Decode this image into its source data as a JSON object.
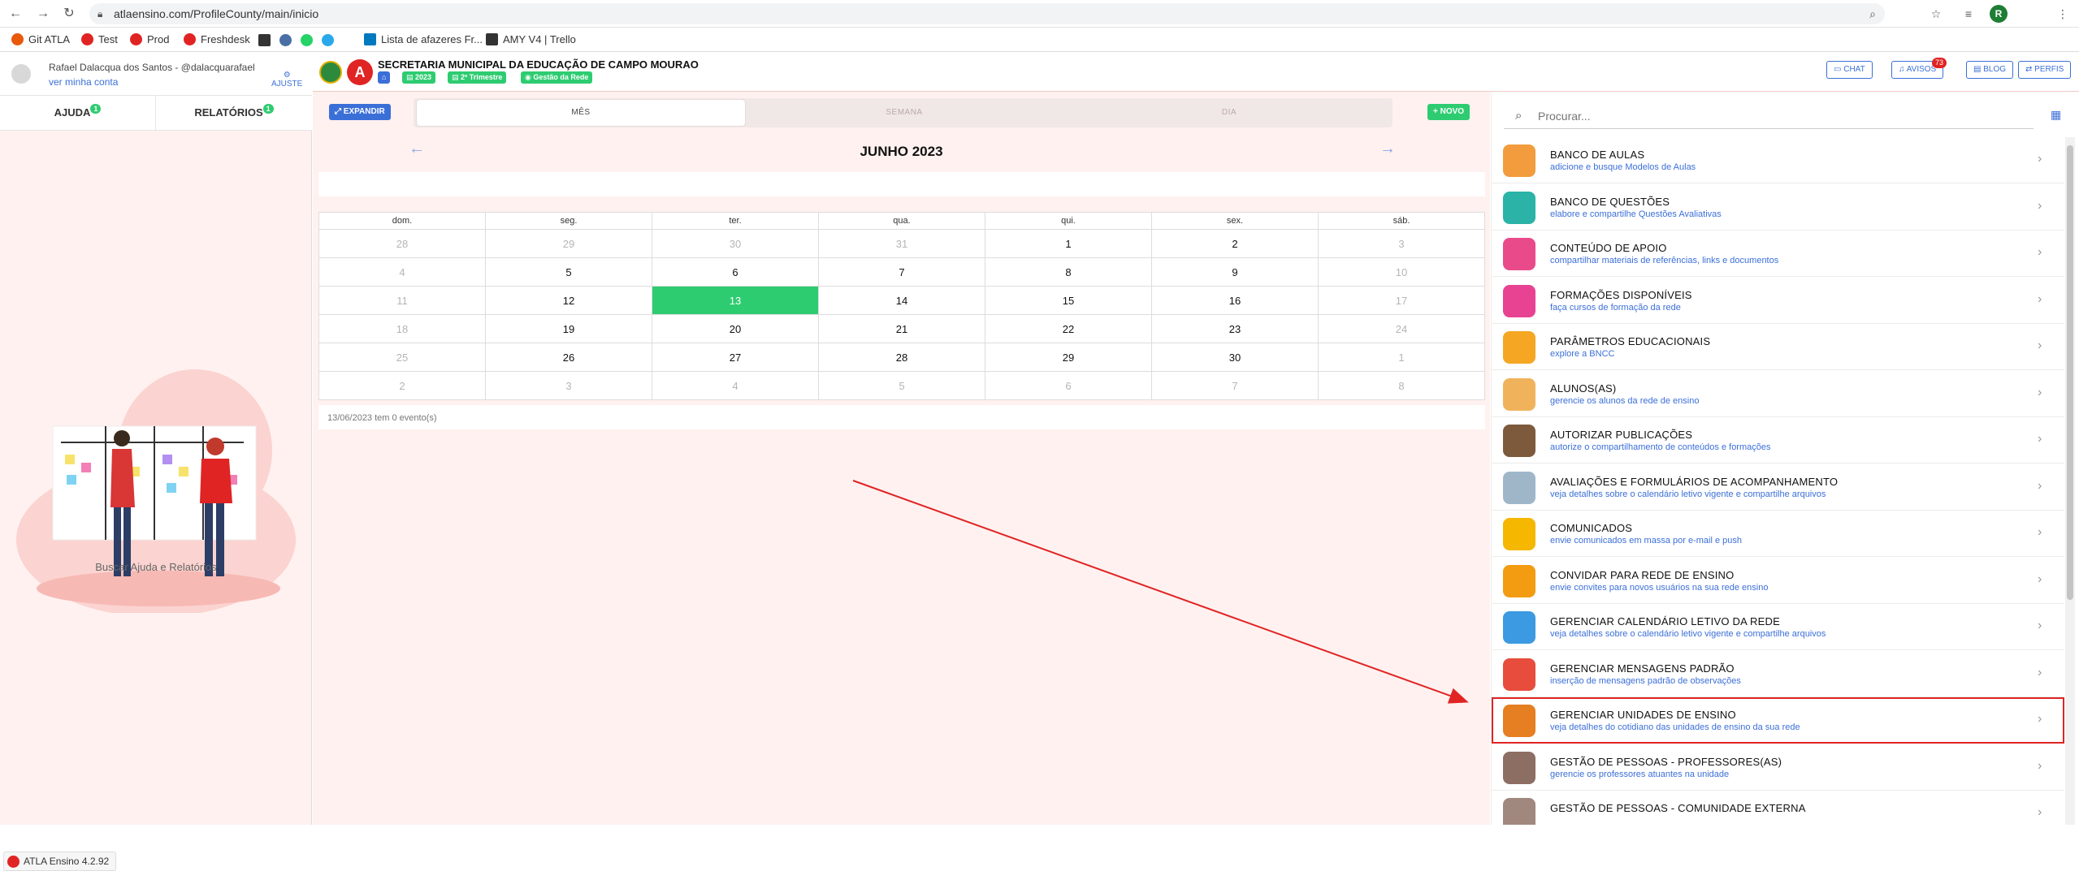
{
  "browser": {
    "url": "atlaensino.com/ProfileCounty/main/inicio",
    "bookmarks": [
      "Git ATLA",
      "Test",
      "Prod",
      "Freshdesk",
      "Lista de afazeres Fr...",
      "AMY V4 | Trello"
    ],
    "profile_initial": "R"
  },
  "user": {
    "name": "Rafael Dalacqua dos Santos - @dalacquarafael",
    "link": "ver minha conta",
    "ajuste": "AJUSTE"
  },
  "left_tabs": [
    {
      "label": "AJUDA",
      "badge": "1"
    },
    {
      "label": "RELATÓRIOS",
      "badge": "1"
    }
  ],
  "help_caption": "Buscar Ajuda e Relatórios",
  "version": "ATLA Ensino 4.2.92",
  "header": {
    "title": "SECRETARIA MUNICIPAL DA EDUCAÇÃO DE CAMPO MOURAO",
    "chips": [
      "2023",
      "2º Trimestre",
      "Gestão da Rede"
    ],
    "buttons": [
      "CHAT",
      "AVISOS",
      "BLOG",
      "PERFIS"
    ],
    "avisos_count": "73"
  },
  "calendar": {
    "expand_label": "EXPANDIR",
    "new_label": "NOVO",
    "views": [
      "MÊS",
      "SEMANA",
      "DIA"
    ],
    "month_title": "JUNHO 2023",
    "weekdays": [
      "dom.",
      "seg.",
      "ter.",
      "qua.",
      "qui.",
      "sex.",
      "sáb."
    ],
    "weeks": [
      [
        "28",
        "29",
        "30",
        "31",
        "1",
        "2",
        "3"
      ],
      [
        "4",
        "5",
        "6",
        "7",
        "8",
        "9",
        "10"
      ],
      [
        "11",
        "12",
        "13",
        "14",
        "15",
        "16",
        "17"
      ],
      [
        "18",
        "19",
        "20",
        "21",
        "22",
        "23",
        "24"
      ],
      [
        "25",
        "26",
        "27",
        "28",
        "29",
        "30",
        "1"
      ],
      [
        "2",
        "3",
        "4",
        "5",
        "6",
        "7",
        "8"
      ]
    ],
    "today": "13",
    "footer": "13/06/2023 tem 0 evento(s)"
  },
  "search": {
    "placeholder": "Procurar..."
  },
  "menu": [
    {
      "title": "BANCO DE AULAS",
      "subtitle": "adicione e busque Modelos de Aulas",
      "icon": "lessons-bank-icon",
      "color": "#f39c3d"
    },
    {
      "title": "BANCO DE QUESTÕES",
      "subtitle": "elabore e compartilhe Questões Avaliativas",
      "icon": "questions-bank-icon",
      "color": "#2ab3a6"
    },
    {
      "title": "CONTEÚDO DE APOIO",
      "subtitle": "compartilhar materiais de referências, links e documentos",
      "icon": "support-content-icon",
      "color": "#e94b8a"
    },
    {
      "title": "FORMAÇÕES DISPONÍVEIS",
      "subtitle": "faça cursos de formação da rede",
      "icon": "training-icon",
      "color": "#e84393"
    },
    {
      "title": "PARÂMETROS EDUCACIONAIS",
      "subtitle": "explore a BNCC",
      "icon": "parameters-icon",
      "color": "#f5a623"
    },
    {
      "title": "ALUNOS(AS)",
      "subtitle": "gerencie os alunos da rede de ensino",
      "icon": "students-icon",
      "color": "#f0b35b"
    },
    {
      "title": "AUTORIZAR PUBLICAÇÕES",
      "subtitle": "autorize o compartilhamento de conteúdos e formações",
      "icon": "authorize-icon",
      "color": "#7d5a3c"
    },
    {
      "title": "AVALIAÇÕES E FORMULÁRIOS DE ACOMPANHAMENTO",
      "subtitle": "veja detalhes sobre o calendário letivo vigente e compartilhe arquivos",
      "icon": "forms-icon",
      "color": "#9fb6c9"
    },
    {
      "title": "COMUNICADOS",
      "subtitle": "envie comunicados em massa por e-mail e push",
      "icon": "email-icon",
      "color": "#f5b700"
    },
    {
      "title": "CONVIDAR PARA REDE DE ENSINO",
      "subtitle": "envie convites para novos usuários na sua rede ensino",
      "icon": "medal-icon",
      "color": "#f39c12"
    },
    {
      "title": "GERENCIAR CALENDÁRIO LETIVO DA REDE",
      "subtitle": "veja detalhes sobre o calendário letivo vigente e compartilhe arquivos",
      "icon": "calendar-icon",
      "color": "#3b9ae1"
    },
    {
      "title": "GERENCIAR MENSAGENS PADRÃO",
      "subtitle": "inserção de mensagens padrão de observações",
      "icon": "messages-icon",
      "color": "#e74c3c"
    },
    {
      "title": "GERENCIAR UNIDADES DE ENSINO",
      "subtitle": "veja detalhes do cotidiano das unidades de ensino da sua rede",
      "icon": "school-icon",
      "color": "#e67e22",
      "highlight": true
    },
    {
      "title": "GESTÃO DE PESSOAS - PROFESSORES(AS)",
      "subtitle": "gerencie os professores atuantes na unidade",
      "icon": "teachers-icon",
      "color": "#8d6e63"
    },
    {
      "title": "GESTÃO DE PESSOAS - COMUNIDADE EXTERNA",
      "subtitle": "",
      "icon": "community-icon",
      "color": "#a1887f"
    }
  ]
}
